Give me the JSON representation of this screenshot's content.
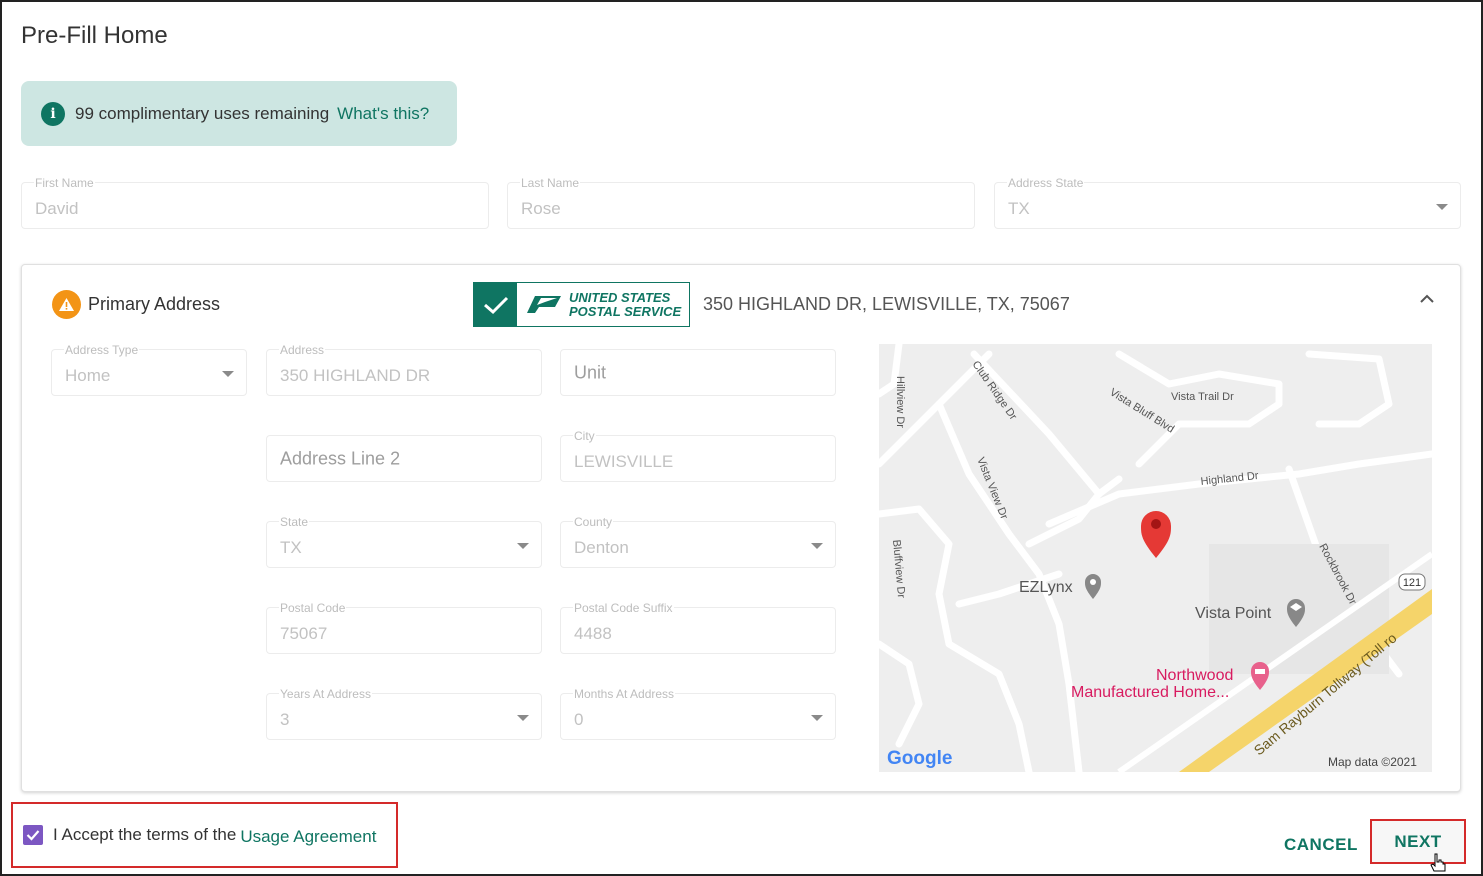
{
  "page": {
    "title": "Pre-Fill Home"
  },
  "banner": {
    "text": "99 complimentary uses remaining",
    "link": "What's this?",
    "icon": "info-icon"
  },
  "applicant": {
    "first_name": {
      "label": "First Name",
      "value": "David"
    },
    "last_name": {
      "label": "Last Name",
      "value": "Rose"
    },
    "address_state": {
      "label": "Address State",
      "value": "TX"
    }
  },
  "primary_address": {
    "heading": "Primary Address",
    "status_icon": "warning-icon",
    "usps_logo_line1": "UNITED STATES",
    "usps_logo_line2": "POSTAL SERVICE",
    "verified_address": "350 HIGHLAND DR, LEWISVILLE, TX, 75067",
    "fields": {
      "address_type": {
        "label": "Address Type",
        "value": "Home"
      },
      "address": {
        "label": "Address",
        "value": "350 HIGHLAND DR"
      },
      "unit": {
        "placeholder": "Unit"
      },
      "address_line2": {
        "placeholder": "Address Line 2"
      },
      "city": {
        "label": "City",
        "value": "LEWISVILLE"
      },
      "state": {
        "label": "State",
        "value": "TX"
      },
      "county": {
        "label": "County",
        "value": "Denton"
      },
      "postal_code": {
        "label": "Postal Code",
        "value": "75067"
      },
      "postal_code_suffix": {
        "label": "Postal Code Suffix",
        "value": "4488"
      },
      "years_at_address": {
        "label": "Years At Address",
        "value": "3"
      },
      "months_at_address": {
        "label": "Months At Address",
        "value": "0"
      }
    }
  },
  "map": {
    "streets": [
      "Hillview Dr",
      "Club Ridge Dr",
      "Vista Bluff Blvd",
      "Vista Trail Dr",
      "Highland Dr",
      "Vista View Dr",
      "Bluffview Dr",
      "Rockbrook Dr",
      "Sam Rayburn Tollway (Toll ro"
    ],
    "shield": "121",
    "places": [
      {
        "name": "EZLynx"
      },
      {
        "name": "Vista Point"
      },
      {
        "name": "Northwood",
        "name2": "Manufactured Home..."
      }
    ],
    "brand": "Google",
    "attribution": "Map data ©2021",
    "colors": {
      "background": "#eeeeee",
      "road": "#ffffff",
      "tollway": "#f5d46a",
      "pin": "#e53935",
      "place_pink": "#d81b60"
    }
  },
  "footer": {
    "accept_text": "I Accept the terms of the",
    "agreement_link": "Usage Agreement",
    "accepted": true,
    "cancel": "CANCEL",
    "next": "NEXT"
  },
  "colors": {
    "accent": "#0f7562",
    "warning": "#f39416",
    "checkbox": "#7c57c2",
    "highlight_border": "#d42a2a"
  }
}
